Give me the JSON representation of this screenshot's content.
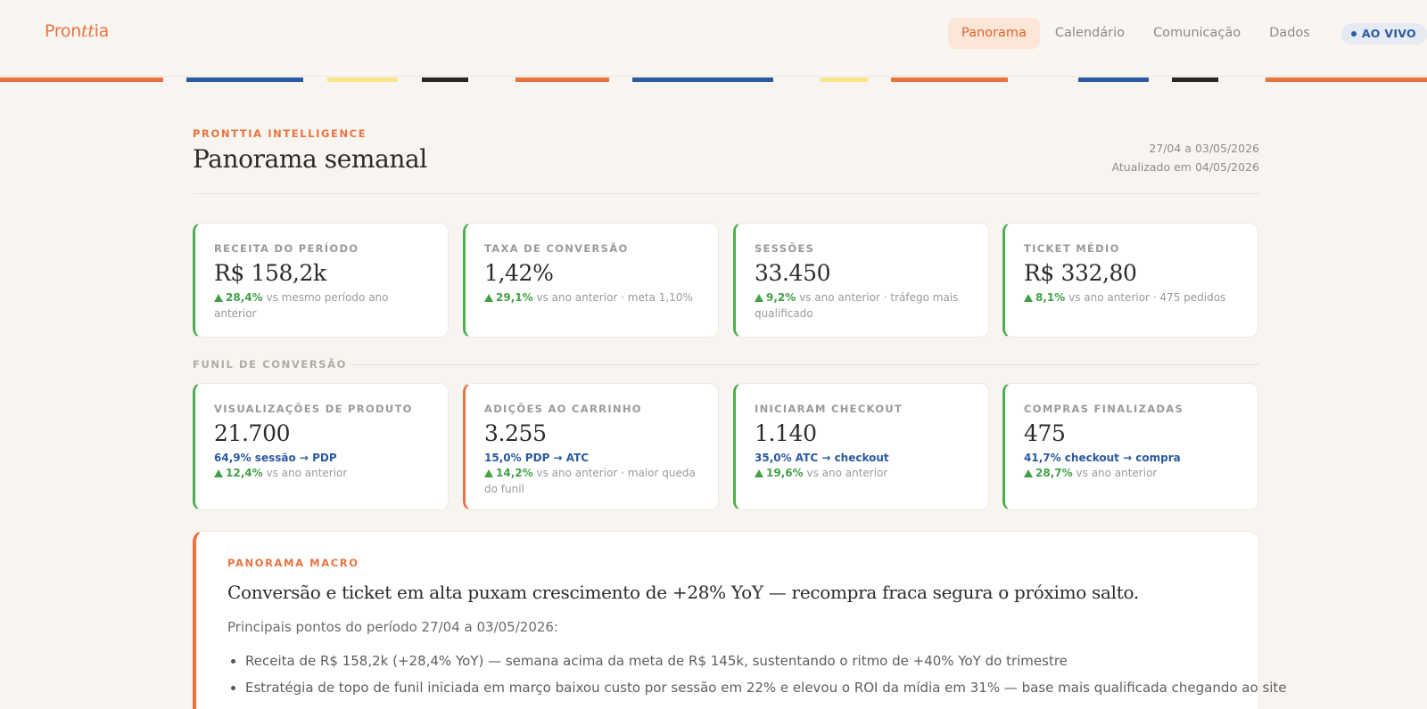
{
  "app": {
    "logo_part1": "Pron",
    "logo_part2": "tt",
    "logo_part3": "ia"
  },
  "nav": {
    "items": [
      "Panorama",
      "Calendário",
      "Comunicação",
      "Dados"
    ],
    "active": "Panorama",
    "live_label": "AO VIVO"
  },
  "header": {
    "kicker": "PRONTTIA INTELLIGENCE",
    "title": "Panorama semanal",
    "period": "27/04 a 03/05/2026",
    "updated": "Atualizado em 04/05/2026"
  },
  "kpis": [
    {
      "label": "RECEITA DO PERÍODO",
      "value": "R$ 158,2k",
      "delta": "28,4%",
      "note": "vs mesmo período ano anterior"
    },
    {
      "label": "TAXA DE CONVERSÃO",
      "value": "1,42%",
      "delta": "29,1%",
      "note": "vs ano anterior · meta 1,10%"
    },
    {
      "label": "SESSÕES",
      "value": "33.450",
      "delta": "9,2%",
      "note": "vs ano anterior · tráfego mais qualificado"
    },
    {
      "label": "TICKET MÉDIO",
      "value": "R$ 332,80",
      "delta": "8,1%",
      "note": "vs ano anterior · 475 pedidos"
    }
  ],
  "funnel": {
    "section_label": "FUNIL DE CONVERSÃO",
    "steps": [
      {
        "label": "VISUALIZAÇÕES DE PRODUTO",
        "value": "21.700",
        "rate": "64,9% sessão → PDP",
        "delta": "12,4%",
        "note": "vs ano anterior"
      },
      {
        "label": "ADIÇÕES AO CARRINHO",
        "value": "3.255",
        "rate": "15,0% PDP → ATC",
        "delta": "14,2%",
        "note": "vs ano anterior · maior queda do funil"
      },
      {
        "label": "INICIARAM CHECKOUT",
        "value": "1.140",
        "rate": "35,0% ATC → checkout",
        "delta": "19,6%",
        "note": "vs ano anterior"
      },
      {
        "label": "COMPRAS FINALIZADAS",
        "value": "475",
        "rate": "41,7% checkout → compra",
        "delta": "28,7%",
        "note": "vs ano anterior"
      }
    ]
  },
  "macro": {
    "kicker": "PANORAMA MACRO",
    "headline": "Conversão e ticket em alta puxam crescimento de +28% YoY — recompra fraca segura o próximo salto.",
    "intro": "Principais pontos do período 27/04 a 03/05/2026:",
    "bullets": [
      "Receita de R$ 158,2k (+28,4% YoY) — semana acima da meta de R$ 145k, sustentando o ritmo de +40% YoY do trimestre",
      "Estratégia de topo de funil iniciada em março baixou custo por sessão em 22% e elevou o ROI da mídia em 31% — base mais qualificada chegando ao site"
    ]
  },
  "colors": {
    "accent": "#e8733f",
    "blue": "#2b5aa0",
    "positive": "#43a047",
    "yellow": "#f7e58a",
    "dark": "#2a2522"
  }
}
